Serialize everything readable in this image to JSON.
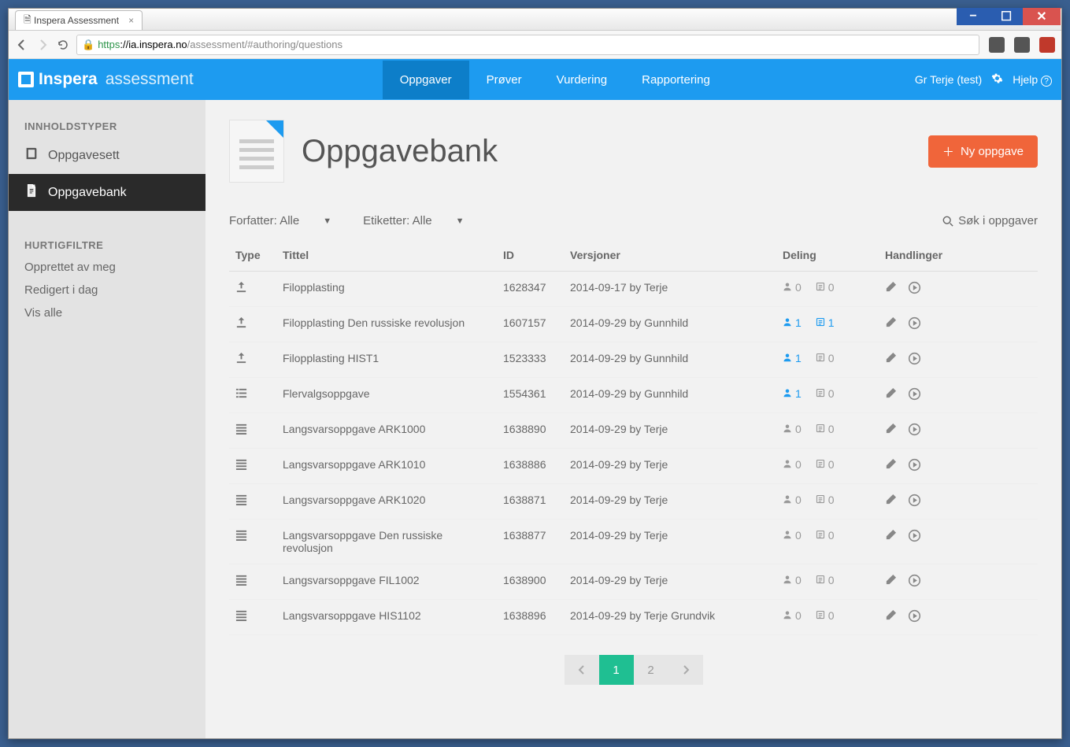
{
  "browser": {
    "tab_title": "Inspera Assessment",
    "url_secure": "https",
    "url_host": "://ia.inspera.no",
    "url_path": "/assessment/#authoring/questions"
  },
  "header": {
    "brand1": "Inspera",
    "brand2": "assessment",
    "nav": [
      "Oppgaver",
      "Prøver",
      "Vurdering",
      "Rapportering"
    ],
    "active_nav": 0,
    "user": "Gr  Terje  (test)",
    "help": "Hjelp"
  },
  "sidebar": {
    "section1": "INNHOLDSTYPER",
    "items": [
      {
        "label": "Oppgavesett",
        "icon": "book"
      },
      {
        "label": "Oppgavebank",
        "icon": "file",
        "active": true
      }
    ],
    "section2": "HURTIGFILTRE",
    "filters": [
      "Opprettet av meg",
      "Redigert i dag",
      "Vis alle"
    ]
  },
  "main": {
    "title": "Oppgavebank",
    "new_btn": "Ny oppgave",
    "filter1": "Forfatter: Alle",
    "filter2": "Etiketter: Alle",
    "search": "Søk i oppgaver",
    "columns": [
      "Type",
      "Tittel",
      "ID",
      "Versjoner",
      "Deling",
      "Handlinger"
    ],
    "rows": [
      {
        "type": "upload",
        "title": "Filopplasting",
        "id": "1628347",
        "ver": "2014-09-17 by Terje",
        "share_u": 0,
        "share_t": 0,
        "u_on": false,
        "t_on": false
      },
      {
        "type": "upload",
        "title": "Filopplasting Den russiske revolusjon",
        "id": "1607157",
        "ver": "2014-09-29 by Gunnhild",
        "share_u": 1,
        "share_t": 1,
        "u_on": true,
        "t_on": true
      },
      {
        "type": "upload",
        "title": "Filopplasting HIST1",
        "id": "1523333",
        "ver": "2014-09-29 by  Gunnhild",
        "share_u": 1,
        "share_t": 0,
        "u_on": true,
        "t_on": false
      },
      {
        "type": "mc",
        "title": "Flervalgsoppgave",
        "id": "1554361",
        "ver": "2014-09-29 by Gunnhild",
        "share_u": 1,
        "share_t": 0,
        "u_on": true,
        "t_on": false
      },
      {
        "type": "essay",
        "title": "Langsvarsoppgave ARK1000",
        "id": "1638890",
        "ver": "2014-09-29 by Terje",
        "share_u": 0,
        "share_t": 0,
        "u_on": false,
        "t_on": false
      },
      {
        "type": "essay",
        "title": "Langsvarsoppgave ARK1010",
        "id": "1638886",
        "ver": "2014-09-29 by Terje",
        "share_u": 0,
        "share_t": 0,
        "u_on": false,
        "t_on": false
      },
      {
        "type": "essay",
        "title": "Langsvarsoppgave ARK1020",
        "id": "1638871",
        "ver": "2014-09-29 by Terje",
        "share_u": 0,
        "share_t": 0,
        "u_on": false,
        "t_on": false
      },
      {
        "type": "essay",
        "title": "Langsvarsoppgave Den russiske revolusjon",
        "id": "1638877",
        "ver": "2014-09-29 by Terje",
        "share_u": 0,
        "share_t": 0,
        "u_on": false,
        "t_on": false
      },
      {
        "type": "essay",
        "title": "Langsvarsoppgave FIL1002",
        "id": "1638900",
        "ver": "2014-09-29 by Terje",
        "share_u": 0,
        "share_t": 0,
        "u_on": false,
        "t_on": false
      },
      {
        "type": "essay",
        "title": "Langsvarsoppgave HIS1102",
        "id": "1638896",
        "ver": "2014-09-29 by Terje Grundvik",
        "share_u": 0,
        "share_t": 0,
        "u_on": false,
        "t_on": false
      }
    ],
    "pages": [
      "1",
      "2"
    ],
    "current_page": 0
  }
}
